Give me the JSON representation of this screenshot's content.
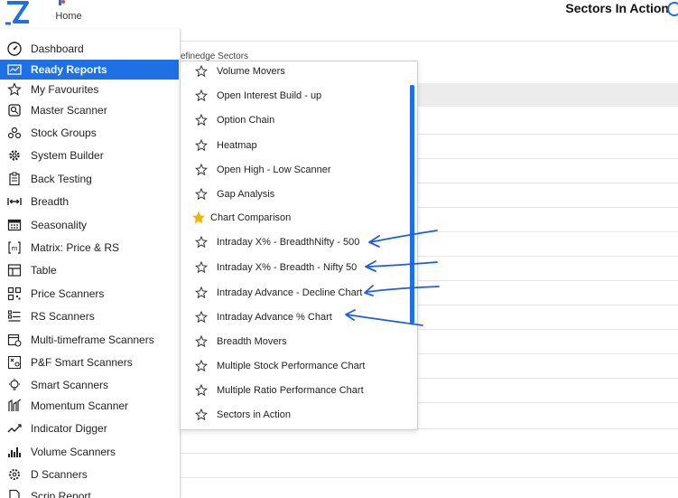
{
  "header": {
    "home_label": "Home",
    "page_title": "Sectors In Action"
  },
  "background": {
    "caption": "efinedge Sectors"
  },
  "colors": {
    "accent": "#1f6fe5",
    "star_filled": "#f5b301"
  },
  "menu": {
    "items": [
      {
        "label": "Dashboard",
        "icon": "dashboard-icon"
      },
      {
        "label": "Ready Reports",
        "icon": "report-icon",
        "active": true
      },
      {
        "label": "My Favourites",
        "icon": "star-icon"
      },
      {
        "label": "Master Scanner",
        "icon": "scanner-icon"
      },
      {
        "label": "Stock Groups",
        "icon": "groups-icon"
      },
      {
        "label": "System Builder",
        "icon": "gear-icon"
      },
      {
        "label": "Back Testing",
        "icon": "clipboard-icon"
      },
      {
        "label": "Breadth",
        "icon": "breadth-icon"
      },
      {
        "label": "Seasonality",
        "icon": "calendar-icon"
      },
      {
        "label": "Matrix: Price & RS",
        "icon": "matrix-icon"
      },
      {
        "label": "Table",
        "icon": "table-icon"
      },
      {
        "label": "Price Scanners",
        "icon": "qr-icon"
      },
      {
        "label": "RS Scanners",
        "icon": "list-icon"
      },
      {
        "label": "Multi-timeframe Scanners",
        "icon": "calendar-clock-icon"
      },
      {
        "label": "P&F Smart Scanners",
        "icon": "pnf-icon"
      },
      {
        "label": "Smart Scanners",
        "icon": "bulb-icon"
      },
      {
        "label": "Momentum Scanner",
        "icon": "momentum-icon"
      },
      {
        "label": "Indicator Digger",
        "icon": "trend-icon"
      },
      {
        "label": "Volume Scanners",
        "icon": "bars-icon"
      },
      {
        "label": "D Scanners",
        "icon": "gear-small-icon"
      },
      {
        "label": "Scrip Report",
        "icon": "doc-icon"
      }
    ]
  },
  "submenu": {
    "items": [
      {
        "label": "Volume Movers",
        "favourite": false
      },
      {
        "label": "Open Interest Build - up",
        "favourite": false
      },
      {
        "label": "Option Chain",
        "favourite": false
      },
      {
        "label": "Heatmap",
        "favourite": false
      },
      {
        "label": "Open High - Low Scanner",
        "favourite": false
      },
      {
        "label": "Gap Analysis",
        "favourite": false
      },
      {
        "label": "Chart Comparison",
        "favourite": true
      },
      {
        "label": "Intraday X% - BreadthNifty - 500",
        "favourite": false
      },
      {
        "label": "Intraday X% - Breadth - Nifty 50",
        "favourite": false
      },
      {
        "label": "Intraday Advance - Decline Chart",
        "favourite": false
      },
      {
        "label": "Intraday Advance % Chart",
        "favourite": false
      },
      {
        "label": "Breadth Movers",
        "favourite": false
      },
      {
        "label": "Multiple Stock Performance Chart",
        "favourite": false
      },
      {
        "label": "Multiple Ratio Performance Chart",
        "favourite": false
      },
      {
        "label": "Sectors in Action",
        "favourite": false
      }
    ]
  }
}
